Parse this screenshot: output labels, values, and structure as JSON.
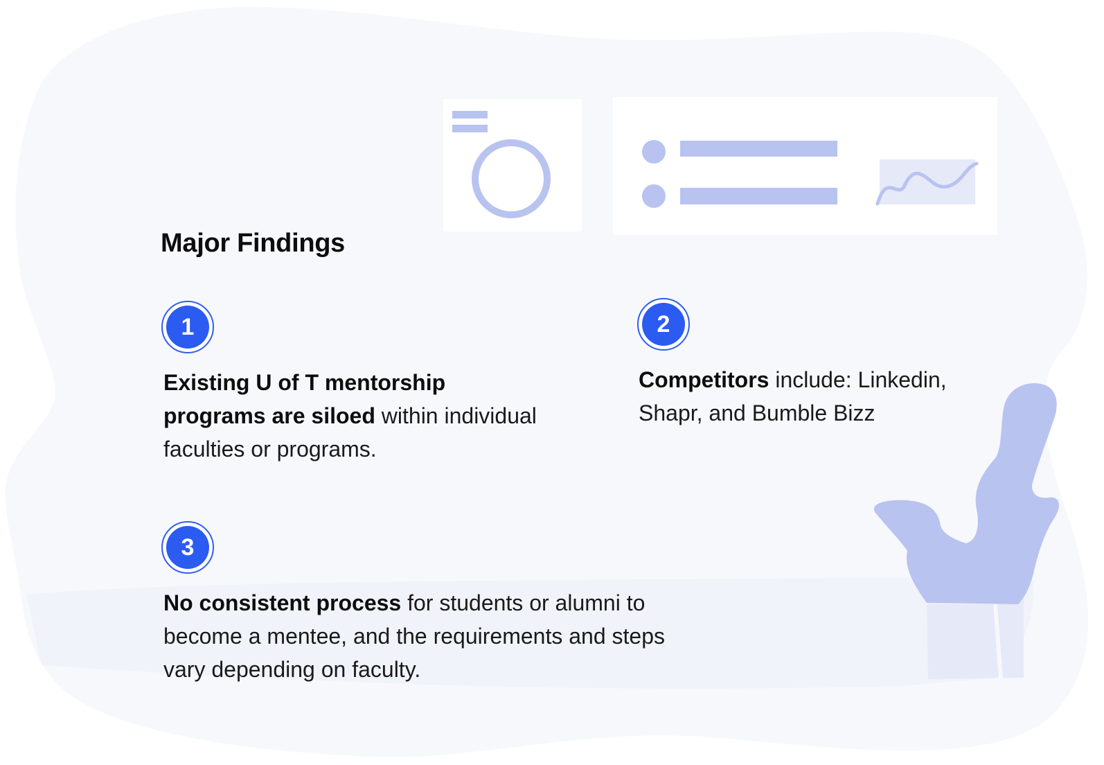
{
  "heading": "Major Findings",
  "colors": {
    "blob": "#f7f8fc",
    "accent": "#2c5bf2",
    "illustration": "#b8c3ef",
    "illustration_light": "#e6e9f8",
    "card": "#ffffff"
  },
  "findings": [
    {
      "number": "1",
      "bold": "Existing U of T mentorship programs are siloed",
      "rest": " within individual faculties or programs."
    },
    {
      "number": "2",
      "bold": "Competitors",
      "rest": " include: Linkedin, Shapr, and Bumble Bizz"
    },
    {
      "number": "3",
      "bold": "No consistent process",
      "rest": " for students or alumni to become a mentee, and the requirements and steps vary depending on faculty."
    }
  ],
  "illustration": {
    "icons": [
      "avatar-card-icon",
      "list-chart-card-icon",
      "plant-icon"
    ]
  }
}
